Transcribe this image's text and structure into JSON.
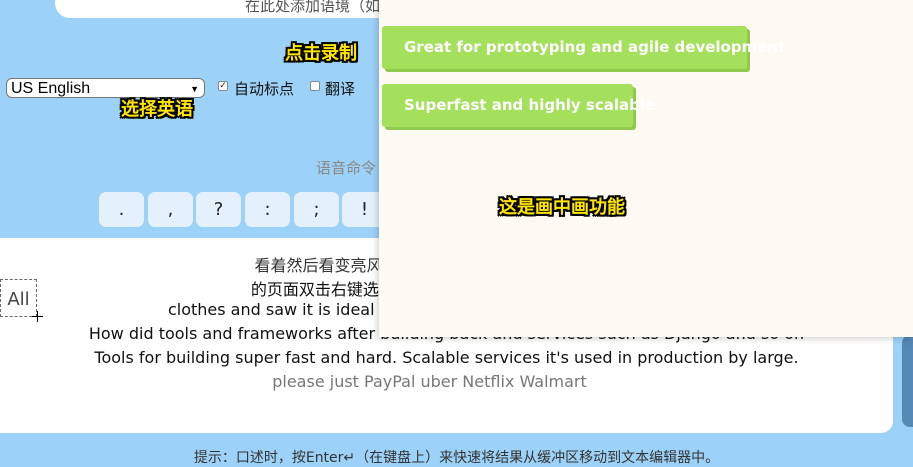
{
  "context": {
    "placeholder_partial": "在此处添加语境（如说"
  },
  "language": {
    "selected": "US English"
  },
  "options": {
    "auto_punct": "自动标点",
    "translate": "翻译"
  },
  "callouts": {
    "record": "点击录制",
    "english": "选择英语",
    "pip": "这是画中画功能"
  },
  "voice_command_label": "语音命令",
  "punctuation": [
    ".",
    ",",
    "?",
    ":",
    ";",
    "!"
  ],
  "editor": {
    "lines": [
      "看着然后看变亮风果小就可以于吗忌家一个保用这样的",
      "的页面双击右键选择画中画在这 what is what m",
      "clothes and saw it is ideal fo",
      "How did tools and frameworks after building back and services such as Django and so on",
      "Tools for building super fast and hard. Scalable services it's used in production by large.",
      "please just PayPal uber Netflix Walmart"
    ],
    "all_button": "All"
  },
  "hint": "提示：口述时，按Enter↵（在键盘上）来快速将结果从缓冲区移动到文本编辑器中。",
  "pip": {
    "buttons": [
      "Great for prototyping and agile development",
      "Superfast and highly scalable"
    ]
  },
  "colors": {
    "background": "#9dd2f8",
    "pip_button": "#a5e05d",
    "callout_text": "#ffe600"
  }
}
